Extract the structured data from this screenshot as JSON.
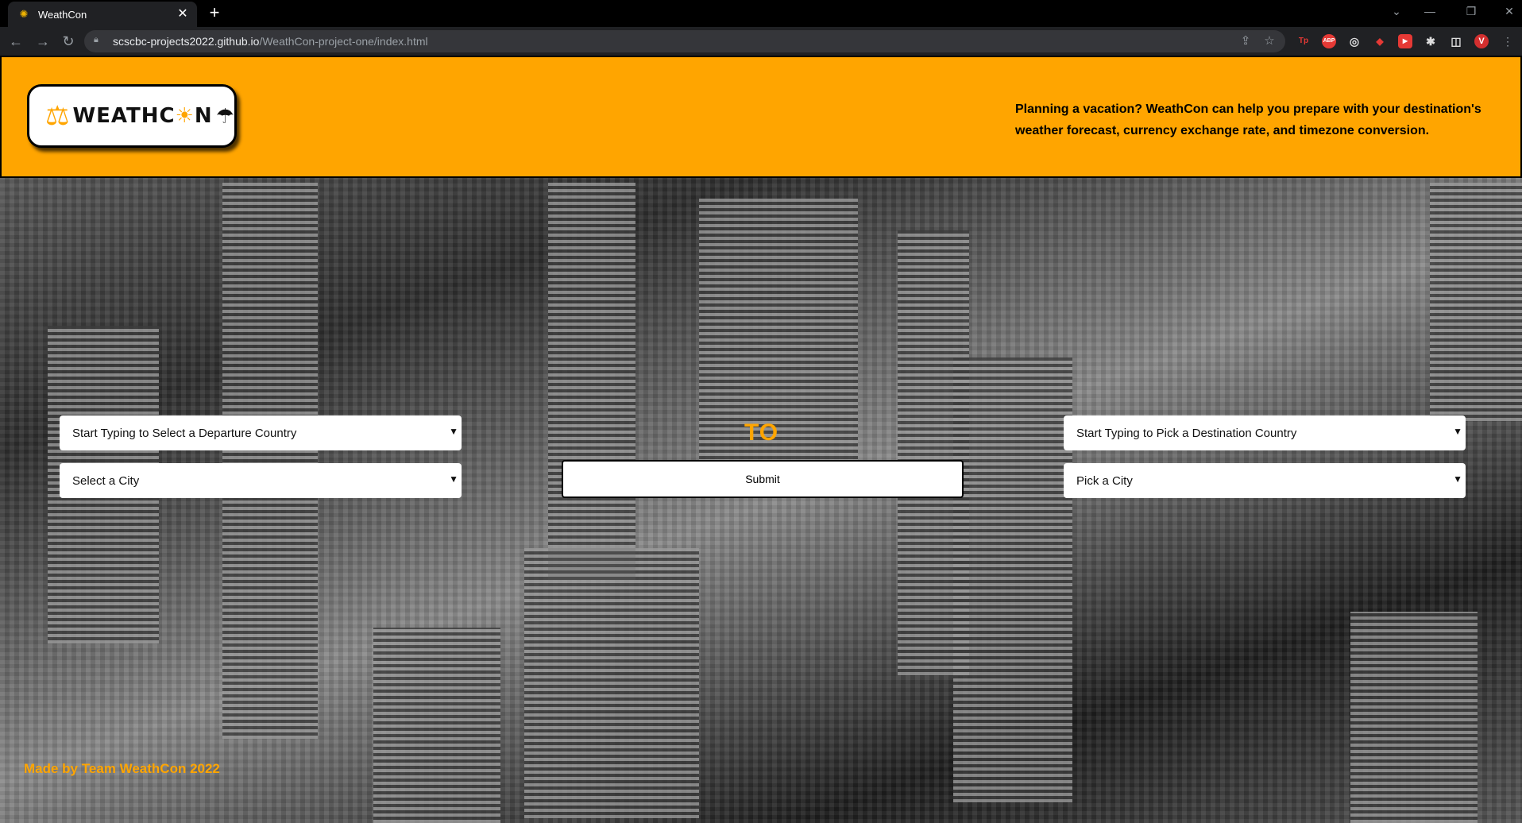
{
  "browser": {
    "tab_title": "WeathCon",
    "url_host": "scscbc-projects2022.github.io",
    "url_path": "/WeathCon-project-one/index.html",
    "extensions": [
      "Tp",
      "ABP",
      "◎",
      "●",
      "▶",
      "✱",
      "◫",
      "V"
    ]
  },
  "header": {
    "logo_text_pre": "WEATHC",
    "logo_text_post": "N",
    "tagline": "Planning a vacation? WeathCon can help you prepare with your destination's weather forecast, currency exchange rate, and timezone conversion."
  },
  "form": {
    "departure_country": "Start Typing to Select a Departure Country",
    "departure_city": "Select a City",
    "to_label": "TO",
    "submit_label": "Submit",
    "destination_country": "Start Typing to Pick a Destination Country",
    "destination_city": "Pick a City"
  },
  "footer": {
    "credit": "Made by Team WeathCon 2022"
  },
  "colors": {
    "accent": "#FFA500",
    "chrome_dark": "#202124"
  }
}
